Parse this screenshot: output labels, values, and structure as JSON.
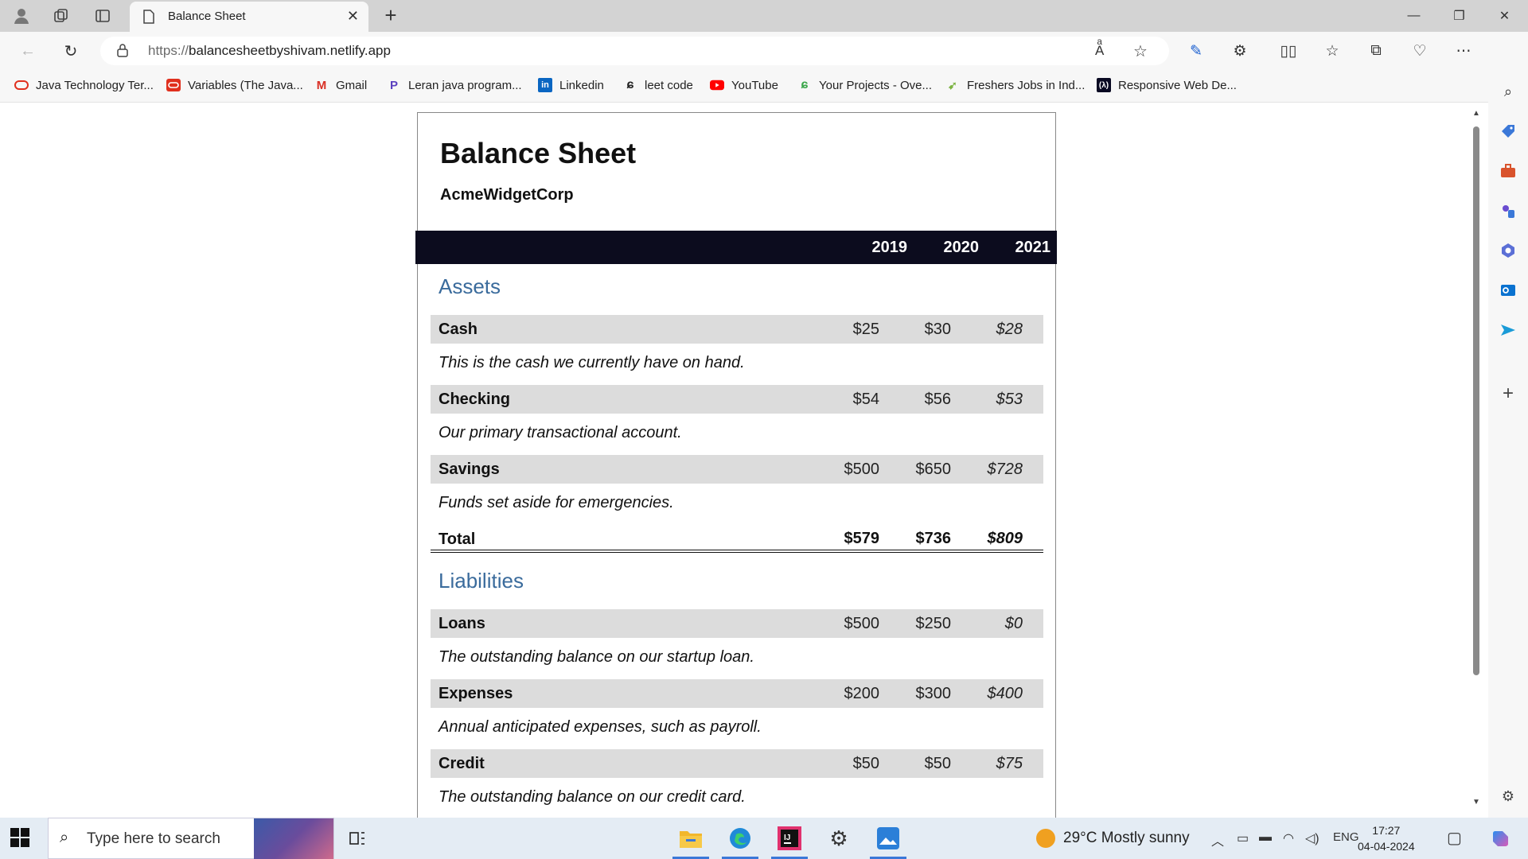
{
  "browser": {
    "tab_title": "Balance Sheet",
    "url_protocol": "https://",
    "url_host": "balancesheetbyshivam.netlify.app"
  },
  "bookmarks": [
    {
      "label": "Java Technology Ter...",
      "icon": "oracle-icon",
      "color": "#e0301e"
    },
    {
      "label": "Variables (The Java...",
      "icon": "oracle-icon",
      "color": "#e0301e"
    },
    {
      "label": "Gmail",
      "icon": "gmail-icon",
      "color": "#d93025"
    },
    {
      "label": "Leran java program...",
      "icon": "javatpoint-icon",
      "color": "#5a3fbf"
    },
    {
      "label": "Linkedin",
      "icon": "linkedin-icon",
      "color": "#0a66c2"
    },
    {
      "label": "leet code",
      "icon": "leetcode-icon",
      "color": "#222222"
    },
    {
      "label": "YouTube",
      "icon": "youtube-icon",
      "color": "#ff0000"
    },
    {
      "label": "Your Projects - Ove...",
      "icon": "projects-icon",
      "color": "#3aa64a"
    },
    {
      "label": "Freshers Jobs in Ind...",
      "icon": "jobs-icon",
      "color": "#7cb342"
    },
    {
      "label": "Responsive Web De...",
      "icon": "freecodecamp-icon",
      "color": "#0a0a23"
    }
  ],
  "sheet": {
    "title": "Balance Sheet",
    "company": "AcmeWidgetCorp",
    "years": [
      "2019",
      "2020",
      "2021"
    ],
    "assets": {
      "title": "Assets",
      "rows": [
        {
          "label": "Cash",
          "values": [
            "$25",
            "$30",
            "$28"
          ],
          "description": "This is the cash we currently have on hand."
        },
        {
          "label": "Checking",
          "values": [
            "$54",
            "$56",
            "$53"
          ],
          "description": "Our primary transactional account."
        },
        {
          "label": "Savings",
          "values": [
            "$500",
            "$650",
            "$728"
          ],
          "description": "Funds set aside for emergencies."
        }
      ],
      "total": {
        "label": "Total",
        "values": [
          "$579",
          "$736",
          "$809"
        ]
      }
    },
    "liabilities": {
      "title": "Liabilities",
      "rows": [
        {
          "label": "Loans",
          "values": [
            "$500",
            "$250",
            "$0"
          ],
          "description": "The outstanding balance on our startup loan."
        },
        {
          "label": "Expenses",
          "values": [
            "$200",
            "$300",
            "$400"
          ],
          "description": "Annual anticipated expenses, such as payroll."
        },
        {
          "label": "Credit",
          "values": [
            "$50",
            "$50",
            "$75"
          ],
          "description": "The outstanding balance on our credit card."
        }
      ]
    }
  },
  "taskbar": {
    "search_placeholder": "Type here to search",
    "weather": "29°C  Mostly sunny",
    "language": "ENG",
    "time": "17:27",
    "date": "04-04-2024"
  },
  "colors": {
    "accent_blue": "#3a6b9c",
    "header_dark": "#0c0c1e",
    "row_gray": "#dcdcdc"
  }
}
